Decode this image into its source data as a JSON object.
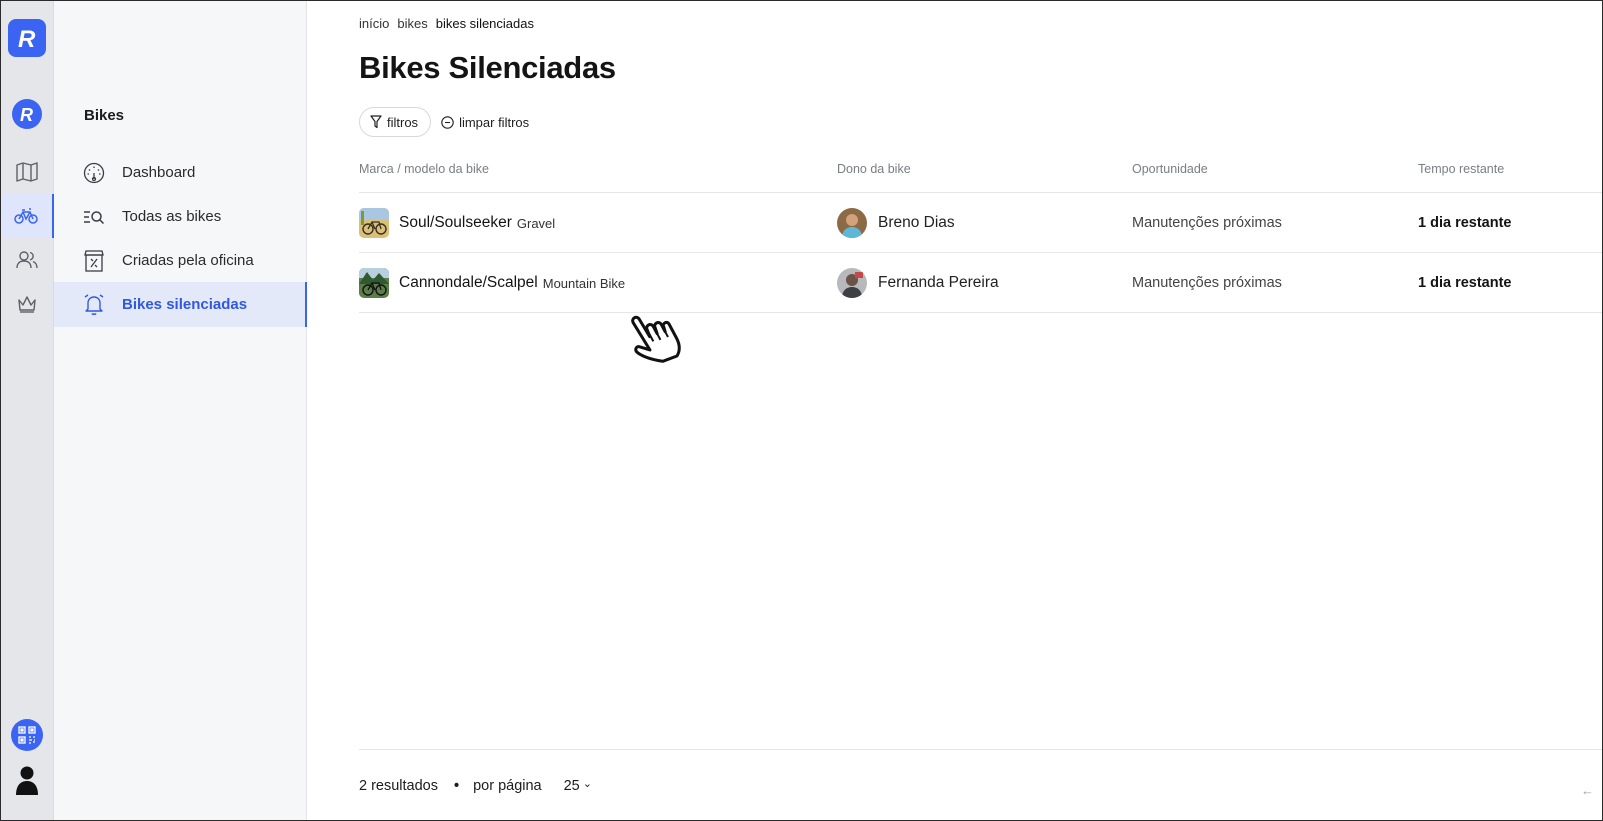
{
  "brand": {
    "logo_letter": "R",
    "accent": "#3b64f2"
  },
  "rail": {
    "items": [
      {
        "name": "map-icon",
        "active": false
      },
      {
        "name": "bike-icon",
        "active": true
      },
      {
        "name": "users-icon",
        "active": false
      },
      {
        "name": "crown-icon",
        "active": false
      }
    ]
  },
  "sidebar": {
    "title": "Bikes",
    "items": [
      {
        "label": "Dashboard",
        "icon": "gauge-icon",
        "active": false
      },
      {
        "label": "Todas as bikes",
        "icon": "list-search-icon",
        "active": false
      },
      {
        "label": "Criadas pela oficina",
        "icon": "shop-icon",
        "active": false
      },
      {
        "label": "Bikes silenciadas",
        "icon": "bell-muted-icon",
        "active": true
      }
    ]
  },
  "breadcrumb": {
    "items": [
      "início",
      "bikes"
    ],
    "current": "bikes silenciadas"
  },
  "page": {
    "title": "Bikes Silenciadas"
  },
  "filters": {
    "filter_label": "filtros",
    "clear_label": "limpar filtros"
  },
  "table": {
    "headers": [
      "Marca / modelo da bike",
      "Dono da bike",
      "Oportunidade",
      "Tempo restante"
    ],
    "rows": [
      {
        "bike": "Soul/Soulseeker",
        "type": "Gravel",
        "owner": "Breno Dias",
        "opportunity": "Manutenções próximas",
        "time_left": "1 dia restante"
      },
      {
        "bike": "Cannondale/Scalpel",
        "type": "Mountain Bike",
        "owner": "Fernanda Pereira",
        "opportunity": "Manutenções próximas",
        "time_left": "1 dia restante"
      }
    ]
  },
  "footer": {
    "results": "2 resultados",
    "per_page_label": "por página",
    "per_page_value": "25",
    "chevron": "⌄",
    "separator": "•",
    "prev_arrow": "←"
  }
}
